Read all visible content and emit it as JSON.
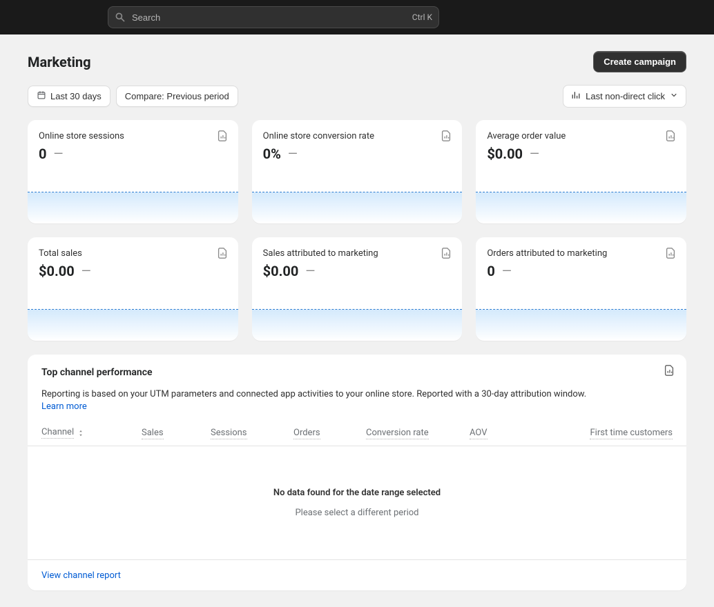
{
  "search": {
    "placeholder": "Search",
    "shortcut": "Ctrl K"
  },
  "header": {
    "title": "Marketing",
    "create_campaign": "Create campaign"
  },
  "filters": {
    "date_range": "Last 30 days",
    "compare": "Compare: Previous period",
    "attribution": "Last non-direct click"
  },
  "cards": [
    {
      "title": "Online store sessions",
      "value": "0",
      "delta": "—"
    },
    {
      "title": "Online store conversion rate",
      "value": "0%",
      "delta": "—"
    },
    {
      "title": "Average order value",
      "value": "$0.00",
      "delta": "—"
    },
    {
      "title": "Total sales",
      "value": "$0.00",
      "delta": "—"
    },
    {
      "title": "Sales attributed to marketing",
      "value": "$0.00",
      "delta": "—"
    },
    {
      "title": "Orders attributed to marketing",
      "value": "0",
      "delta": "—"
    }
  ],
  "channel_panel": {
    "title": "Top channel performance",
    "description": "Reporting is based on your UTM parameters and connected app activities to your online store. Reported with a 30-day attribution window.",
    "learn_more": "Learn more",
    "columns": {
      "channel": "Channel",
      "sales": "Sales",
      "sessions": "Sessions",
      "orders": "Orders",
      "conv": "Conversion rate",
      "aov": "AOV",
      "ftc": "First time customers"
    },
    "empty_title": "No data found for the date range selected",
    "empty_sub": "Please select a different period",
    "view_report": "View channel report"
  }
}
